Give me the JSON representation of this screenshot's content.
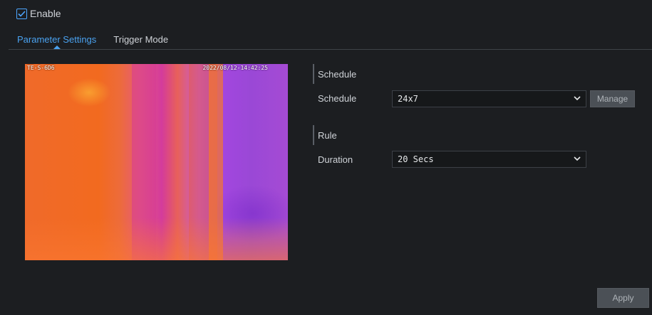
{
  "enable": {
    "label": "Enable",
    "checked": true
  },
  "tabs": [
    {
      "label": "Parameter Settings",
      "active": true
    },
    {
      "label": "Trigger Mode",
      "active": false
    }
  ],
  "video": {
    "osd_left": "TE-S-6D6",
    "osd_right": "2022/08/12-14:42:25"
  },
  "schedule_section": {
    "title": "Schedule",
    "field_label": "Schedule",
    "value": "24x7",
    "manage_label": "Manage"
  },
  "rule_section": {
    "title": "Rule",
    "field_label": "Duration",
    "value": "20 Secs"
  },
  "apply_label": "Apply",
  "colors": {
    "accent": "#4aa2f0",
    "background": "#1c1e21",
    "button": "#4b5056"
  },
  "icons": {
    "checkbox": "check-icon",
    "dropdown": "chevron-down-icon"
  }
}
